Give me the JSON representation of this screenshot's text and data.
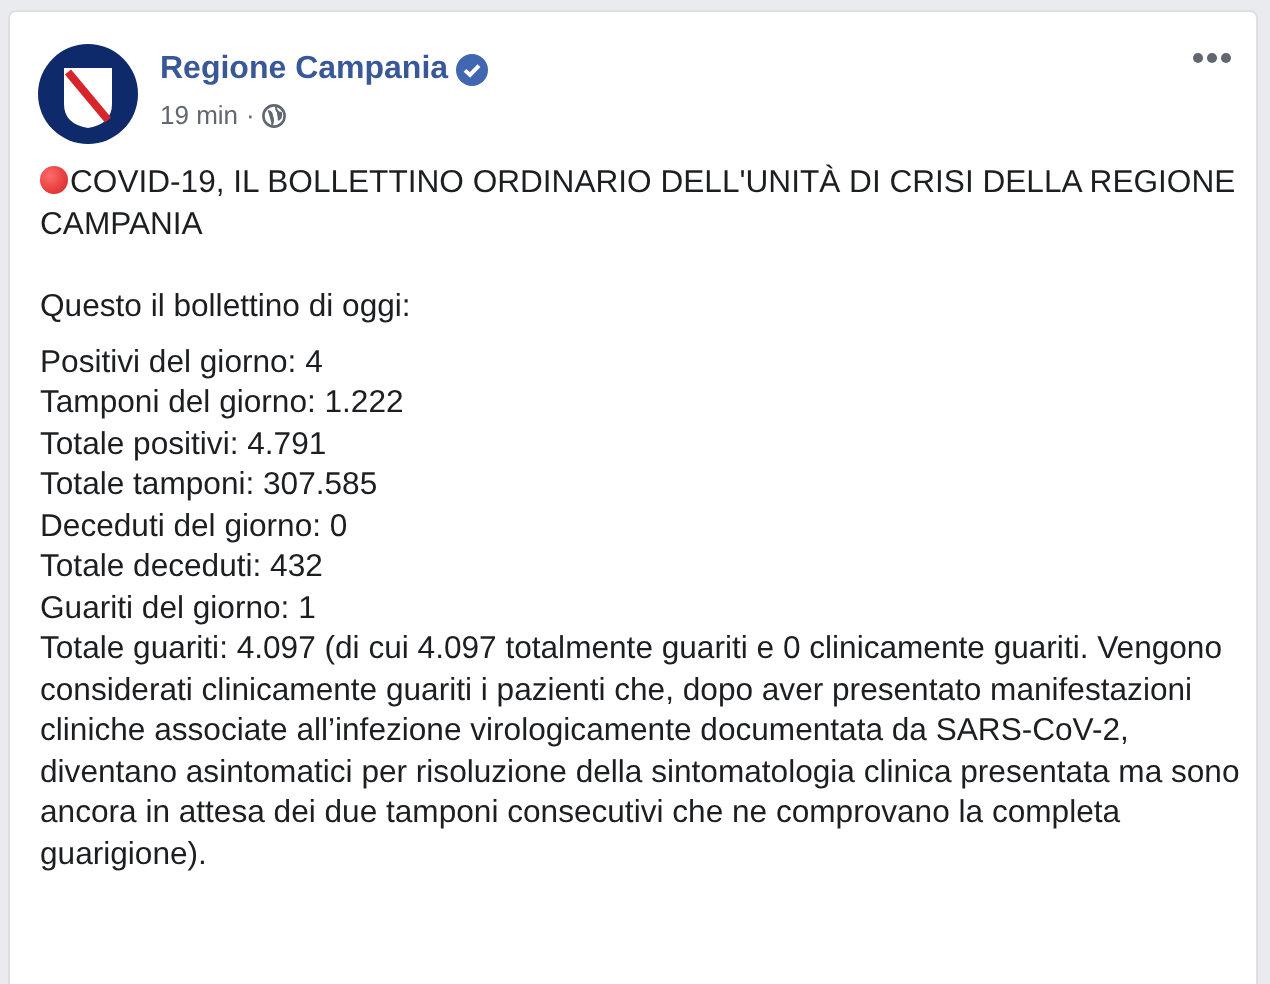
{
  "post": {
    "author": "Regione Campania",
    "verified": true,
    "time": "19 min",
    "separator": "·",
    "title": "COVID-19, IL BOLLETTINO ORDINARIO DELL'UNITÀ DI CRISI DELLA REGIONE CAMPANIA",
    "intro": "Questo il bollettino di oggi:",
    "lines": [
      "Positivi del giorno: 4",
      "Tamponi del giorno: 1.222",
      "Totale positivi: 4.791",
      "Totale tamponi: 307.585",
      "Deceduti del giorno: 0",
      "Totale deceduti: 432",
      "Guariti del giorno: 1"
    ],
    "note": "Totale guariti: 4.097 (di cui 4.097 totalmente guariti e 0 clinicamente guariti. Vengono considerati clinicamente guariti i pazienti che, dopo aver presentato manifestazioni cliniche associate all’infezione virologicamente documentata da SARS-CoV-2, diventano asintomatici per risoluzione della sintomatologia clinica presentata ma sono ancora in attesa dei due tamponi consecutivi che ne comprovano la completa guarigione)."
  }
}
